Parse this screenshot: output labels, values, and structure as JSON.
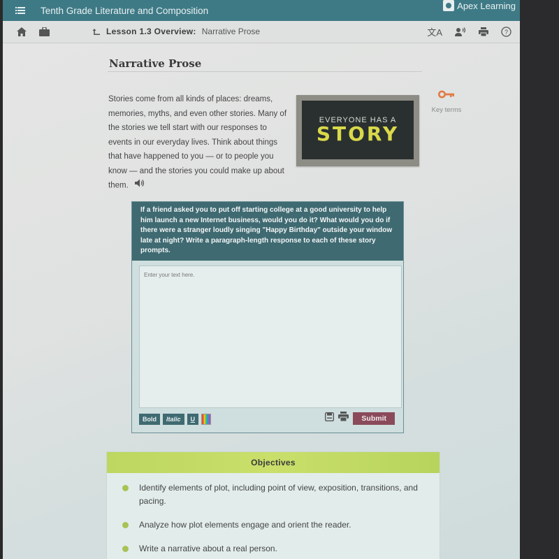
{
  "header": {
    "course_title": "Tenth Grade Literature and Composition",
    "brand": "Apex Learning",
    "colors": {
      "primary": "#3e7a86",
      "submit": "#8a4a5a",
      "accent_key": "#e07b45",
      "objectives": "#bdd760"
    }
  },
  "subbar": {
    "lesson_label": "Lesson 1.3 Overview:",
    "lesson_topic": "Narrative Prose",
    "icons": [
      "home-icon",
      "briefcase-icon",
      "translate-icon",
      "read-aloud-icon",
      "print-icon",
      "help-icon"
    ]
  },
  "main": {
    "section_title": "Narrative Prose",
    "intro_text": "Stories come from all kinds of places: dreams, memories, myths, and even other stories. Many of the stories we tell start with our responses to events in our everyday lives. Think about things that have happened to you — or to people you know — and the stories you could make up about them.",
    "image": {
      "line1": "EVERYONE HAS A",
      "line2": "STORY"
    },
    "key_terms_label": "Key terms"
  },
  "prompt": {
    "text": "If a friend asked you to put off starting college at a good university to help him launch a new Internet business, would you do it? What would you do if there were a stranger loudly singing \"Happy Birthday\" outside your window late at night? Write a paragraph-length response to each of these story prompts.",
    "placeholder": "Enter your text here.",
    "value": "",
    "toolbar": {
      "bold": "Bold",
      "italic": "Italic",
      "underline": "U"
    },
    "submit_label": "Submit"
  },
  "objectives": {
    "title": "Objectives",
    "items": [
      "Identify elements of plot, including point of view, exposition, transitions, and pacing.",
      "Analyze how plot elements engage and orient the reader.",
      "Write a narrative about a real person."
    ]
  }
}
